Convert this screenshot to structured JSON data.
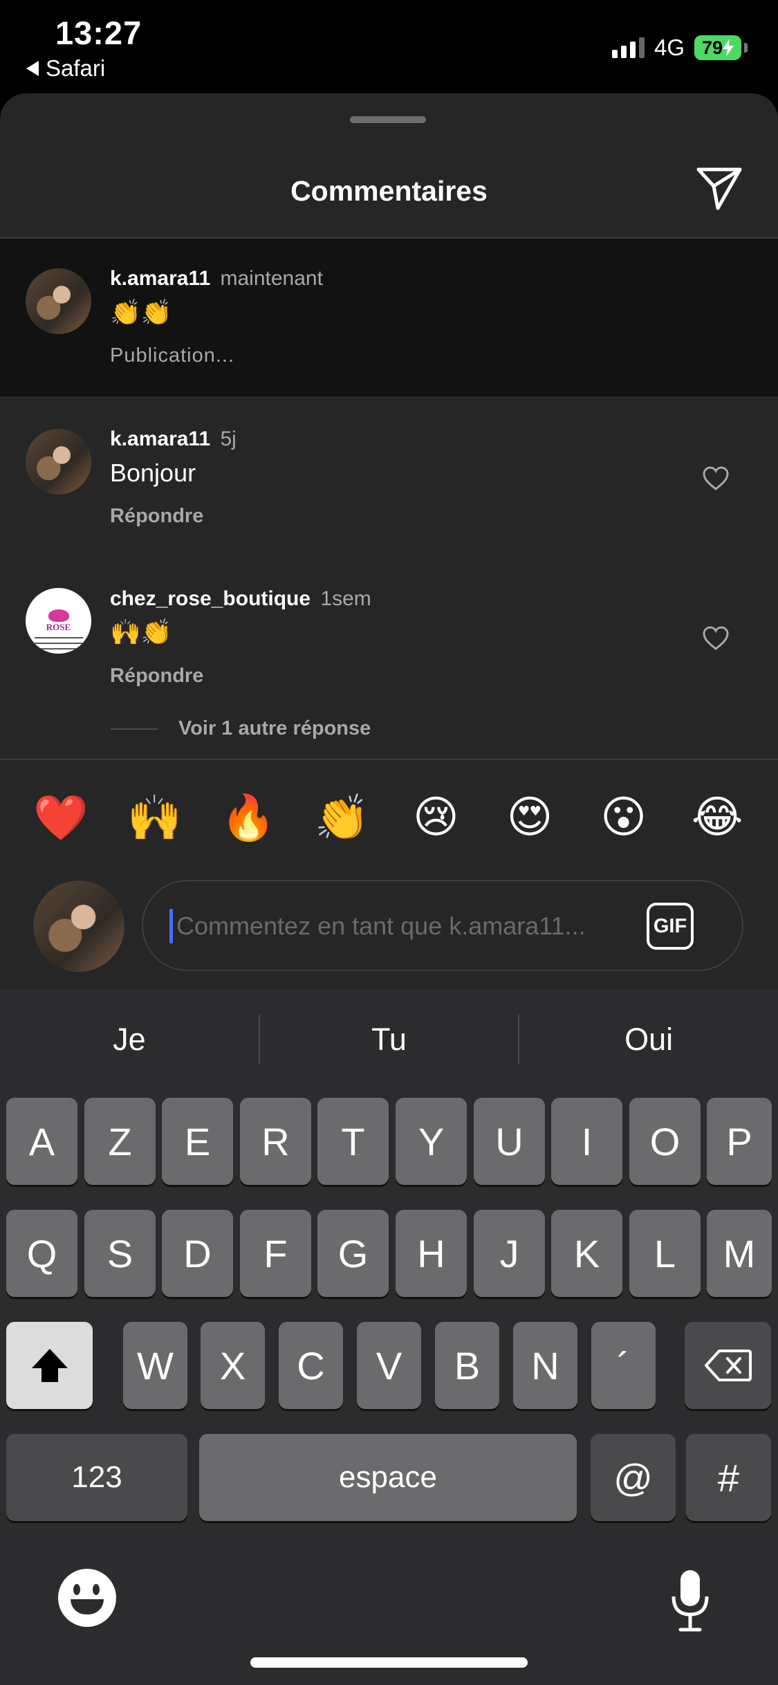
{
  "status_bar": {
    "time": "13:27",
    "back_app": "Safari",
    "network": "4G",
    "battery": "79"
  },
  "sheet": {
    "title": "Commentaires",
    "comments": [
      {
        "username": "k.amara11",
        "time": "maintenant",
        "text": "👏👏",
        "meta": "Publication..."
      },
      {
        "username": "k.amara11",
        "time": "5j",
        "text": "Bonjour",
        "meta": "Répondre"
      },
      {
        "username": "chez_rose_boutique",
        "time": "1sem",
        "text": "🙌👏",
        "meta": "Répondre",
        "avatar_text": "ROSE"
      }
    ],
    "more_replies": "Voir 1 autre réponse"
  },
  "reactions": [
    "❤️",
    "🙌",
    "🔥",
    "👏",
    "😢",
    "😍",
    "😮",
    "😂"
  ],
  "input": {
    "placeholder": "Commentez en tant que k.amara11...",
    "gif_label": "GIF"
  },
  "keyboard": {
    "suggestions": [
      "Je",
      "Tu",
      "Oui"
    ],
    "row1": [
      "A",
      "Z",
      "E",
      "R",
      "T",
      "Y",
      "U",
      "I",
      "O",
      "P"
    ],
    "row2": [
      "Q",
      "S",
      "D",
      "F",
      "G",
      "H",
      "J",
      "K",
      "L",
      "M"
    ],
    "row3": [
      "W",
      "X",
      "C",
      "V",
      "B",
      "N",
      "´"
    ],
    "numbers_label": "123",
    "space_label": "espace",
    "at_label": "@",
    "hash_label": "#"
  },
  "icons": {
    "send": "send-icon",
    "heart": "heart-icon",
    "shift": "shift-icon",
    "delete": "backspace-icon",
    "emoji": "emoji-icon",
    "mic": "microphone-icon"
  }
}
